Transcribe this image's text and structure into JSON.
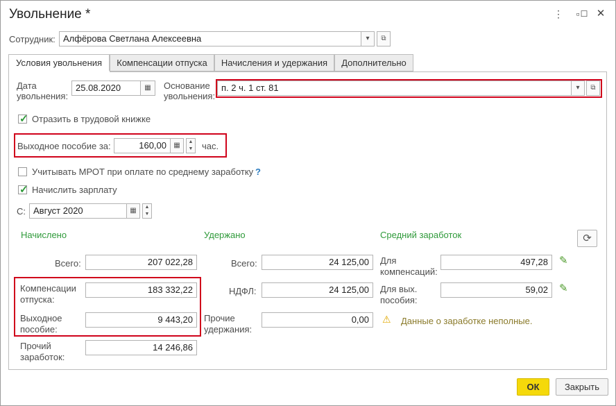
{
  "window": {
    "title": "Увольнение *"
  },
  "employee": {
    "label": "Сотрудник:",
    "value": "Алфёрова Светлана Алексеевна"
  },
  "tabs": [
    {
      "label": "Условия увольнения"
    },
    {
      "label": "Компенсации отпуска"
    },
    {
      "label": "Начисления и удержания"
    },
    {
      "label": "Дополнительно"
    }
  ],
  "dismissal": {
    "date_label_1": "Дата",
    "date_label_2": "увольнения:",
    "date_value": "25.08.2020",
    "reason_label_1": "Основание",
    "reason_label_2": "увольнения:",
    "reason_value": "п. 2 ч. 1 ст. 81"
  },
  "labor_book": {
    "label": "Отразить в трудовой книжке",
    "checked": true
  },
  "severance": {
    "label": "Выходное пособие за:",
    "value": "160,00",
    "unit": "час."
  },
  "mrot": {
    "label": "Учитывать МРОТ при оплате по среднему заработку",
    "checked": false,
    "help": "?"
  },
  "salary": {
    "label": "Начислить зарплату",
    "checked": true
  },
  "period": {
    "label": "С:",
    "value": "Август 2020"
  },
  "accrued": {
    "title": "Начислено",
    "total_label": "Всего:",
    "total": "207 022,28",
    "vacation_label_1": "Компенсации",
    "vacation_label_2": "отпуска:",
    "vacation": "183 332,22",
    "severance_label_1": "Выходное",
    "severance_label_2": "пособие:",
    "severance": "9 443,20",
    "other_label_1": "Прочий",
    "other_label_2": "заработок:",
    "other": "14 246,86"
  },
  "withheld": {
    "title": "Удержано",
    "total_label": "Всего:",
    "total": "24 125,00",
    "ndfl_label": "НДФЛ:",
    "ndfl": "24 125,00",
    "other_label_1": "Прочие",
    "other_label_2": "удержания:",
    "other": "0,00"
  },
  "average": {
    "title": "Средний заработок",
    "comp_label_1": "Для",
    "comp_label_2": "компенсаций:",
    "comp": "497,28",
    "sev_label_1": "Для вых.",
    "sev_label_2": "пособия:",
    "sev": "59,02",
    "warning": "Данные о заработке неполные."
  },
  "footer": {
    "ok": "ОК",
    "close": "Закрыть"
  },
  "colors": {
    "section_green": "#2f9a3a",
    "highlight_red": "#d0021b",
    "ok_yellow": "#f5d90a"
  }
}
